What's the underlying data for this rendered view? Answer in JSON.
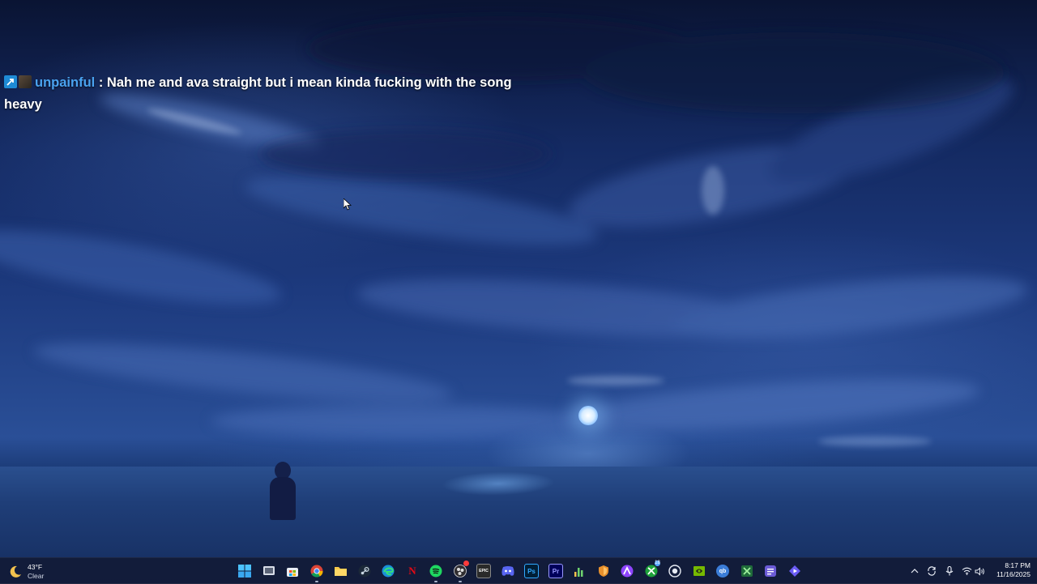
{
  "chat": {
    "username": "unpainful",
    "separator": " : ",
    "message": "Nah me and ava straight but i mean kinda fucking with the song heavy"
  },
  "weather": {
    "temperature": "43°F",
    "condition": "Clear",
    "icon": "moon-icon"
  },
  "taskbar": {
    "apps": [
      {
        "name": "windows-start-icon",
        "glyph": ""
      },
      {
        "name": "task-view-icon",
        "glyph": ""
      },
      {
        "name": "microsoft-store-icon",
        "glyph": ""
      },
      {
        "name": "chrome-icon",
        "glyph": ""
      },
      {
        "name": "file-explorer-icon",
        "glyph": ""
      },
      {
        "name": "steam-icon",
        "glyph": ""
      },
      {
        "name": "edge-icon",
        "glyph": ""
      },
      {
        "name": "netflix-icon",
        "glyph": "N"
      },
      {
        "name": "spotify-icon",
        "glyph": ""
      },
      {
        "name": "obs-icon",
        "glyph": ""
      },
      {
        "name": "epic-games-icon",
        "glyph": "EPIC"
      },
      {
        "name": "discord-icon",
        "glyph": ""
      },
      {
        "name": "photoshop-icon",
        "glyph": "Ps"
      },
      {
        "name": "premiere-pro-icon",
        "glyph": "Pr"
      },
      {
        "name": "audio-meter-icon",
        "glyph": ""
      },
      {
        "name": "shield-app-icon",
        "glyph": ""
      },
      {
        "name": "arc-icon",
        "glyph": ""
      },
      {
        "name": "xbox-icon",
        "glyph": "",
        "badge": "18"
      },
      {
        "name": "camera-app-icon",
        "glyph": ""
      },
      {
        "name": "nvidia-icon",
        "glyph": ""
      },
      {
        "name": "qbittorrent-icon",
        "glyph": "qb"
      },
      {
        "name": "spreadsheet-app-icon",
        "glyph": ""
      },
      {
        "name": "notes-app-icon",
        "glyph": ""
      },
      {
        "name": "media-player-icon",
        "glyph": ""
      }
    ]
  },
  "tray": {
    "icons": [
      "chevron-up-icon",
      "sync-icon",
      "microphone-icon",
      "wifi-icon",
      "volume-icon"
    ]
  },
  "clock": {
    "time": "8:17 PM",
    "date": "11/16/2025"
  }
}
